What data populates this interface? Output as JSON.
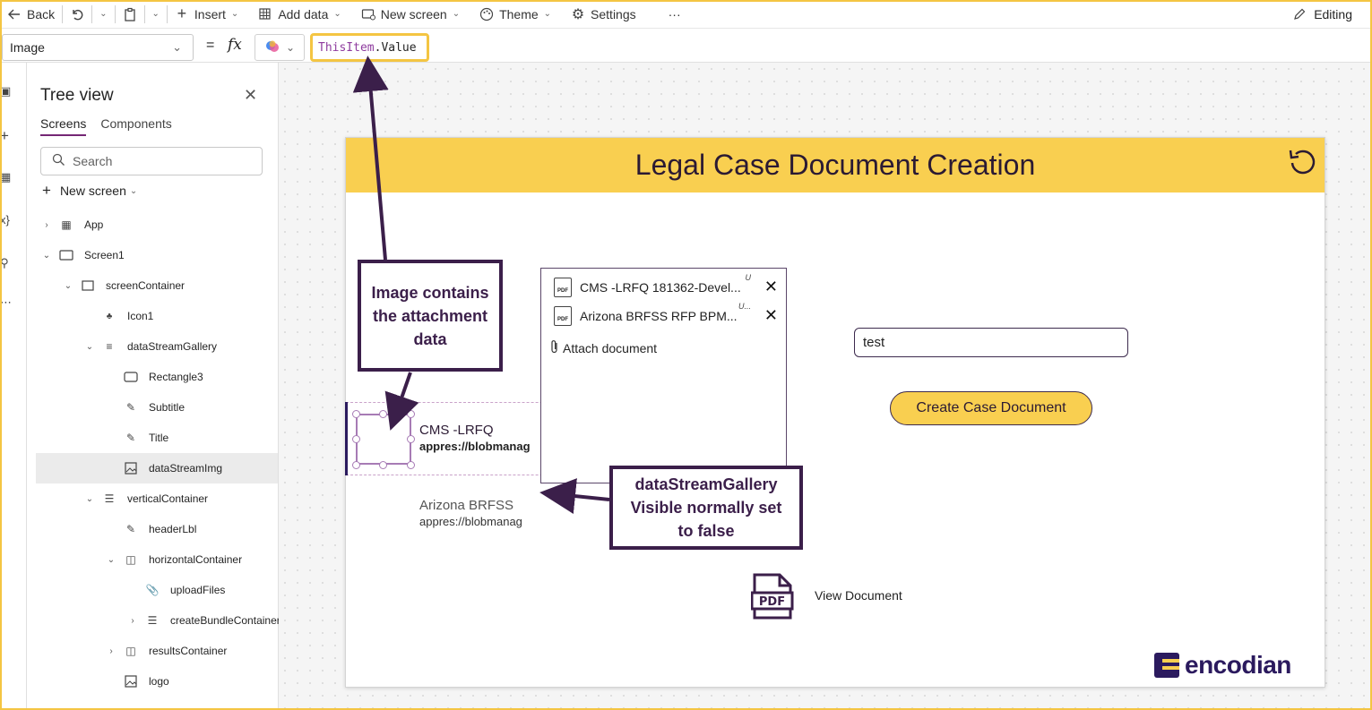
{
  "toolbar": {
    "back": "Back",
    "insert": "Insert",
    "add_data": "Add data",
    "new_screen": "New screen",
    "theme": "Theme",
    "settings": "Settings",
    "more": "···",
    "editing": "Editing"
  },
  "formula_bar": {
    "property": "Image",
    "equals": "=",
    "fx": "fx",
    "formula_keyword": "ThisItem",
    "formula_rest": ".Value"
  },
  "tree": {
    "title": "Tree view",
    "tabs": [
      "Screens",
      "Components"
    ],
    "search_placeholder": "Search",
    "new_screen": "New screen",
    "nodes": [
      {
        "label": "App"
      },
      {
        "label": "Screen1"
      },
      {
        "label": "screenContainer"
      },
      {
        "label": "Icon1"
      },
      {
        "label": "dataStreamGallery"
      },
      {
        "label": "Rectangle3"
      },
      {
        "label": "Subtitle"
      },
      {
        "label": "Title"
      },
      {
        "label": "dataStreamImg"
      },
      {
        "label": "verticalContainer"
      },
      {
        "label": "headerLbl"
      },
      {
        "label": "horizontalContainer"
      },
      {
        "label": "uploadFiles"
      },
      {
        "label": "createBundleContainer"
      },
      {
        "label": "resultsContainer"
      },
      {
        "label": "logo"
      }
    ]
  },
  "app": {
    "title": "Legal Case Document Creation",
    "gallery": [
      {
        "title": "CMS -LRFQ",
        "subtitle": "appres://blobmanag"
      },
      {
        "title": "Arizona BRFSS",
        "subtitle": "appres://blobmanag"
      }
    ],
    "attachments": [
      {
        "name": "CMS -LRFQ 181362-Devel...",
        "badge": "U"
      },
      {
        "name": "Arizona BRFSS RFP BPM...",
        "badge": "U..."
      }
    ],
    "attach_label": "Attach document",
    "input_value": "test",
    "create_button": "Create Case Document",
    "view_document": "View Document",
    "pdf_label": "PDF",
    "logo_text": "encodian"
  },
  "callouts": {
    "image": "Image contains the attachment data",
    "gallery": "dataStreamGallery Visible normally set to false"
  },
  "colors": {
    "accent_yellow": "#f9cf50",
    "purple_dark": "#3b1f4a",
    "highlight": "#f4c542"
  }
}
